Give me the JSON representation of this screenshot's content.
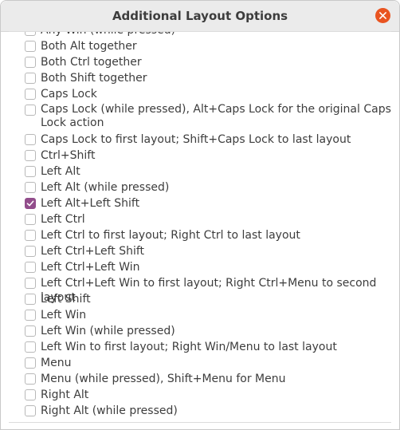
{
  "window": {
    "title": "Additional Layout Options"
  },
  "colors": {
    "accent": "#924d8b",
    "close": "#e95420"
  },
  "options": [
    {
      "label": "Any Win (while pressed)",
      "checked": false
    },
    {
      "label": "Both Alt together",
      "checked": false
    },
    {
      "label": "Both Ctrl together",
      "checked": false
    },
    {
      "label": "Both Shift together",
      "checked": false
    },
    {
      "label": "Caps Lock",
      "checked": false
    },
    {
      "label": "Caps Lock (while pressed), Alt+Caps Lock for the original Caps Lock action",
      "checked": false
    },
    {
      "label": "Caps Lock to first layout; Shift+Caps Lock to last layout",
      "checked": false
    },
    {
      "label": "Ctrl+Shift",
      "checked": false
    },
    {
      "label": "Left Alt",
      "checked": false
    },
    {
      "label": "Left Alt (while pressed)",
      "checked": false
    },
    {
      "label": "Left Alt+Left Shift",
      "checked": true
    },
    {
      "label": "Left Ctrl",
      "checked": false
    },
    {
      "label": "Left Ctrl to first layout; Right Ctrl to last layout",
      "checked": false
    },
    {
      "label": "Left Ctrl+Left Shift",
      "checked": false
    },
    {
      "label": "Left Ctrl+Left Win",
      "checked": false
    },
    {
      "label": "Left Ctrl+Left Win to first layout; Right Ctrl+Menu to second layout",
      "checked": false
    },
    {
      "label": "Left Shift",
      "checked": false
    },
    {
      "label": "Left Win",
      "checked": false
    },
    {
      "label": "Left Win (while pressed)",
      "checked": false
    },
    {
      "label": "Left Win to first layout; Right Win/Menu to last layout",
      "checked": false
    },
    {
      "label": "Menu",
      "checked": false
    },
    {
      "label": "Menu (while pressed), Shift+Menu for Menu",
      "checked": false
    },
    {
      "label": "Right Alt",
      "checked": false
    },
    {
      "label": "Right Alt (while pressed)",
      "checked": false
    }
  ]
}
